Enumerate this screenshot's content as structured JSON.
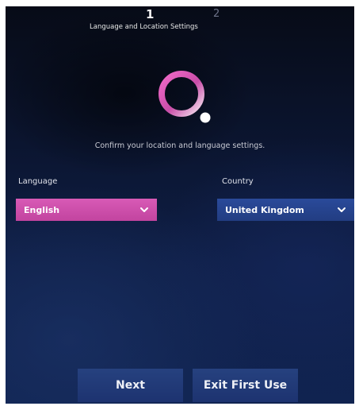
{
  "steps": {
    "current": "1",
    "next": "2",
    "current_label": "Language and Location Settings"
  },
  "instruction": "Confirm your location and language settings.",
  "language": {
    "label": "Language",
    "selected": "English",
    "icon": "chevron-down-icon",
    "color": "#c94da8"
  },
  "country": {
    "label": "Country",
    "selected": "United Kingdom",
    "icon": "chevron-down-icon",
    "color": "#27468f"
  },
  "buttons": {
    "next_label": "Next",
    "exit_label": "Exit First Use"
  },
  "loader_icon": "loading-ring-icon",
  "colors": {
    "accent": "#d24fac",
    "background": "#0c1836",
    "button": "#223a78"
  }
}
